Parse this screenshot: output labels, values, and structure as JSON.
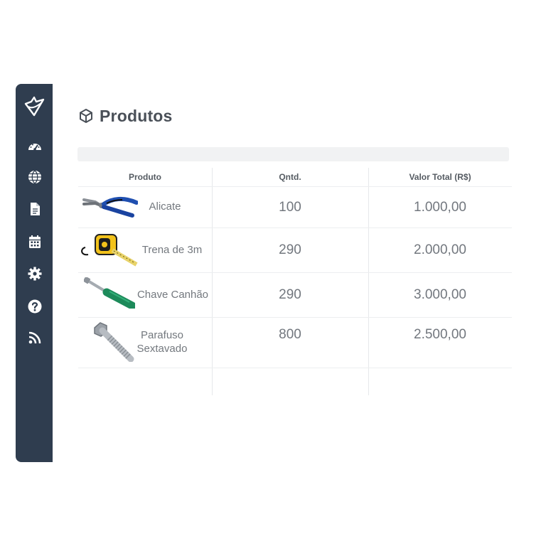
{
  "sidebar": {
    "items": [
      {
        "icon": "dashboard-icon"
      },
      {
        "icon": "globe-icon"
      },
      {
        "icon": "document-icon"
      },
      {
        "icon": "calendar-icon"
      },
      {
        "icon": "gear-icon"
      },
      {
        "icon": "help-icon"
      },
      {
        "icon": "rss-icon"
      }
    ],
    "background": "#2f3d4f"
  },
  "page": {
    "title": "Produtos",
    "title_icon": "cube-icon"
  },
  "table": {
    "columns": [
      "Produto",
      "Qntd.",
      "Valor Total (R$)"
    ],
    "rows": [
      {
        "name": "Alicate",
        "image": "pliers-icon",
        "qty": "100",
        "total": "1.000,00"
      },
      {
        "name": "Trena de 3m",
        "image": "tape-measure-icon",
        "qty": "290",
        "total": "2.000,00"
      },
      {
        "name": "Chave Canhão",
        "image": "nut-driver-icon",
        "qty": "290",
        "total": "3.000,00"
      },
      {
        "name_line1": "Parafuso",
        "name_line2": "Sextavado",
        "image": "hex-bolt-icon",
        "qty": "800",
        "total": "2.500,00"
      }
    ]
  }
}
